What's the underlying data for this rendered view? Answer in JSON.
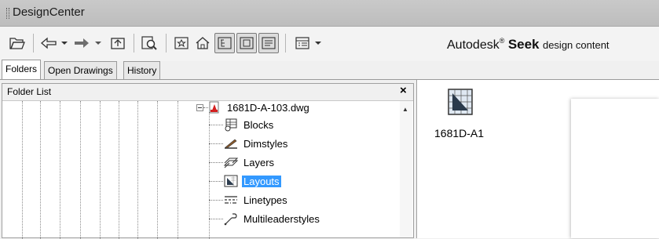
{
  "window": {
    "title": "DesignCenter"
  },
  "toolbar": {
    "icons": [
      "load-folder-icon",
      "back-icon",
      "back-dropdown-icon",
      "forward-icon",
      "forward-dropdown-icon",
      "up-icon",
      "search-icon",
      "favorites-icon",
      "home-icon",
      "tree-view-toggle-icon",
      "preview-toggle-icon",
      "description-toggle-icon",
      "views-icon",
      "views-dropdown-icon"
    ],
    "seek": {
      "brand": "Autodesk",
      "reg": "®",
      "product": "Seek",
      "tagline": "design content"
    }
  },
  "tabs": [
    {
      "label": "Folders",
      "active": true
    },
    {
      "label": "Open Drawings",
      "active": false
    },
    {
      "label": "History",
      "active": false
    }
  ],
  "folder_list": {
    "title": "Folder List",
    "close": "×",
    "drawing": "1681D-A-103.dwg",
    "items": [
      {
        "label": "Blocks",
        "icon": "blocks-icon"
      },
      {
        "label": "Dimstyles",
        "icon": "dimstyles-icon"
      },
      {
        "label": "Layers",
        "icon": "layers-icon"
      },
      {
        "label": "Layouts",
        "icon": "layouts-icon",
        "selected": true
      },
      {
        "label": "Linetypes",
        "icon": "linetypes-icon"
      },
      {
        "label": "Multileaderstyles",
        "icon": "multileaderstyles-icon"
      }
    ]
  },
  "content": {
    "items": [
      {
        "label": "1681D-A1",
        "icon": "layout-icon"
      }
    ]
  },
  "colors": {
    "selection": "#3399ff",
    "titlebar": "#c4c4c4"
  }
}
